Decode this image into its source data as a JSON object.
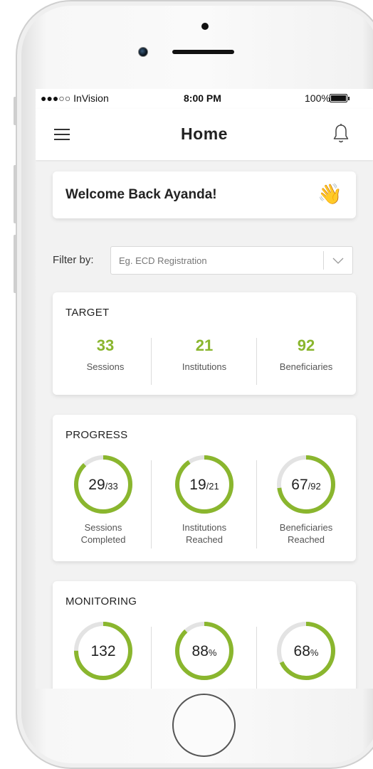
{
  "status_bar": {
    "carrier": "●●●○○ InVision",
    "time": "8:00 PM",
    "battery": "100%"
  },
  "nav": {
    "title": "Home"
  },
  "welcome": {
    "text": "Welcome Back Ayanda!",
    "emoji": "👋"
  },
  "filter": {
    "label": "Filter by:",
    "placeholder": "Eg. ECD Registration"
  },
  "target": {
    "title": "TARGET",
    "stats": [
      {
        "value": "33",
        "label": "Sessions"
      },
      {
        "value": "21",
        "label": "Institutions"
      },
      {
        "value": "92",
        "label": "Beneficiaries"
      }
    ]
  },
  "progress": {
    "title": "PROGRESS",
    "rings": [
      {
        "value": "29",
        "suffix": "/33",
        "fraction": 0.879,
        "label_1": "Sessions",
        "label_2": "Completed"
      },
      {
        "value": "19",
        "suffix": "/21",
        "fraction": 0.905,
        "label_1": "Institutions",
        "label_2": "Reached"
      },
      {
        "value": "67",
        "suffix": "/92",
        "fraction": 0.728,
        "label_1": "Beneficiaries",
        "label_2": "Reached"
      }
    ]
  },
  "monitoring": {
    "title": "MONITORING",
    "rings": [
      {
        "value": "132",
        "suffix": "",
        "fraction": 0.75
      },
      {
        "value": "88",
        "suffix": "%",
        "fraction": 0.88
      },
      {
        "value": "68",
        "suffix": "%",
        "fraction": 0.68
      }
    ]
  },
  "colors": {
    "accent": "#8ab62e",
    "track": "#e3e3e3"
  }
}
